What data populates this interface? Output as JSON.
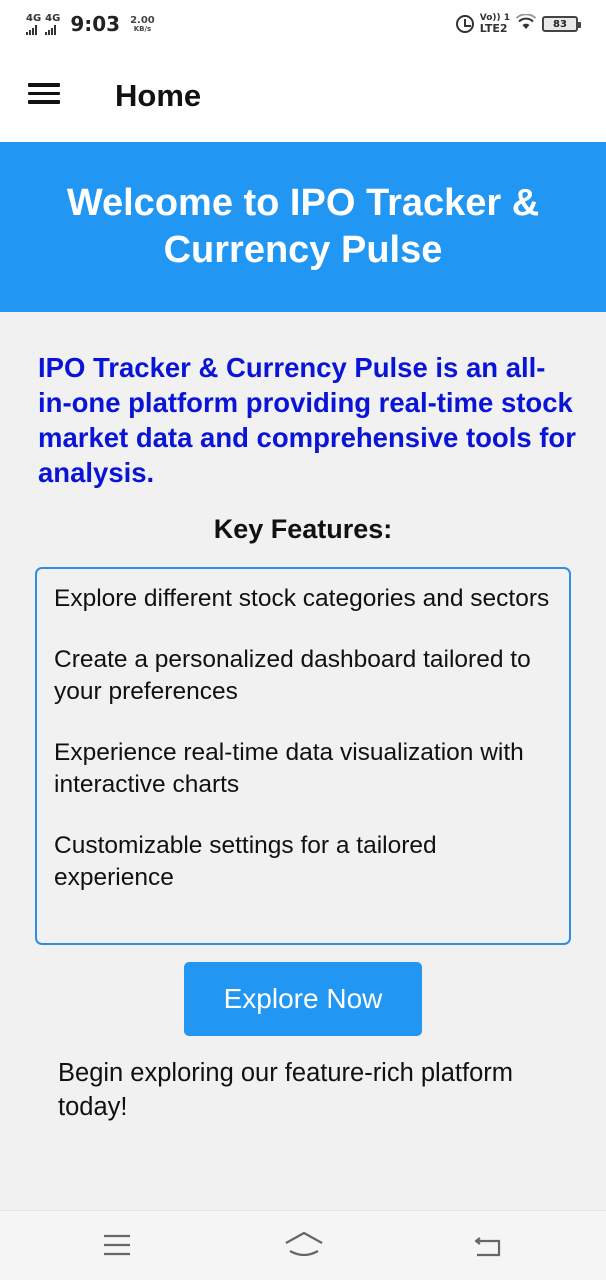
{
  "status_bar": {
    "network1": "4G",
    "network2": "4G",
    "time": "9:03",
    "speed_value": "2.00",
    "speed_unit": "KB/s",
    "volte_label": "Vo)) 1",
    "lte_label": "LTE2",
    "battery_level": "83"
  },
  "app_bar": {
    "title": "Home",
    "menu_icon": "hamburger-menu-icon"
  },
  "banner": {
    "title": "Welcome to IPO Tracker & Currency Pulse",
    "background_color": "#2196f3"
  },
  "intro": {
    "text": "IPO Tracker & Currency Pulse is an all-in-one platform providing real-time stock market data and comprehensive tools for analysis.",
    "color": "#0a14d6"
  },
  "features": {
    "heading": "Key Features:",
    "items": [
      "Explore different stock categories and sectors",
      "Create a personalized dashboard tailored to your preferences",
      "Experience real-time data visualization with interactive charts",
      "Customizable settings for a tailored experience"
    ],
    "border_color": "#2f8de4"
  },
  "cta": {
    "button_label": "Explore Now",
    "closing_text": "Begin exploring our feature-rich platform today!"
  },
  "nav_bar": {
    "icons": [
      "recent-apps-icon",
      "home-icon",
      "back-icon"
    ]
  }
}
